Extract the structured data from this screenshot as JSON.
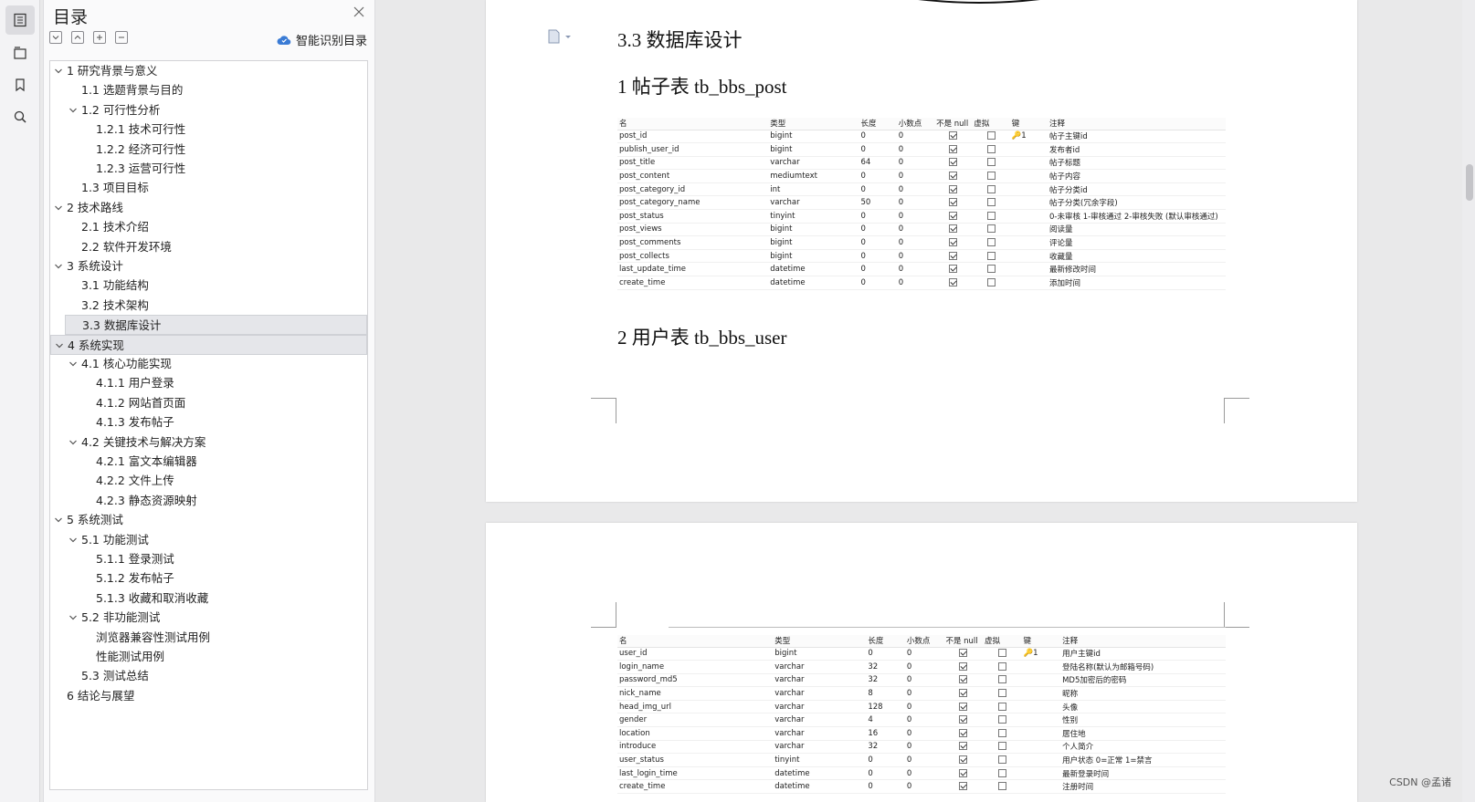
{
  "toc": {
    "title": "目录",
    "smart_label": "智能识别目录",
    "items": [
      {
        "text": "1  研究背景与意义",
        "level": 0,
        "chev": true
      },
      {
        "text": "1.1  选题背景与目的",
        "level": 1,
        "chev": false
      },
      {
        "text": "1.2  可行性分析",
        "level": 1,
        "chev": true
      },
      {
        "text": "1.2.1  技术可行性",
        "level": 2,
        "chev": false
      },
      {
        "text": "1.2.2  经济可行性",
        "level": 2,
        "chev": false
      },
      {
        "text": "1.2.3  运营可行性",
        "level": 2,
        "chev": false
      },
      {
        "text": "1.3  项目目标",
        "level": 1,
        "chev": false
      },
      {
        "text": "2  技术路线",
        "level": 0,
        "chev": true
      },
      {
        "text": "2.1  技术介绍",
        "level": 1,
        "chev": false
      },
      {
        "text": "2.2  软件开发环境",
        "level": 1,
        "chev": false
      },
      {
        "text": "3  系统设计",
        "level": 0,
        "chev": true
      },
      {
        "text": "3.1  功能结构",
        "level": 1,
        "chev": false
      },
      {
        "text": "3.2  技术架构",
        "level": 1,
        "chev": false
      },
      {
        "text": "3.3  数据库设计",
        "level": 1,
        "chev": false,
        "selected": true
      },
      {
        "text": "4  系统实现",
        "level": 0,
        "chev": true,
        "selected": true
      },
      {
        "text": "4.1  核心功能实现",
        "level": 1,
        "chev": true
      },
      {
        "text": "4.1.1  用户登录",
        "level": 2,
        "chev": false
      },
      {
        "text": "4.1.2  网站首页面",
        "level": 2,
        "chev": false
      },
      {
        "text": "4.1.3  发布帖子",
        "level": 2,
        "chev": false
      },
      {
        "text": "4.2  关键技术与解决方案",
        "level": 1,
        "chev": true
      },
      {
        "text": "4.2.1  富文本编辑器",
        "level": 2,
        "chev": false
      },
      {
        "text": "4.2.2  文件上传",
        "level": 2,
        "chev": false
      },
      {
        "text": "4.2.3  静态资源映射",
        "level": 2,
        "chev": false
      },
      {
        "text": "5  系统测试",
        "level": 0,
        "chev": true
      },
      {
        "text": "5.1  功能测试",
        "level": 1,
        "chev": true
      },
      {
        "text": "5.1.1  登录测试",
        "level": 2,
        "chev": false
      },
      {
        "text": "5.1.2  发布帖子",
        "level": 2,
        "chev": false
      },
      {
        "text": "5.1.3  收藏和取消收藏",
        "level": 2,
        "chev": false
      },
      {
        "text": "5.2  非功能测试",
        "level": 1,
        "chev": true
      },
      {
        "text": "浏览器兼容性测试用例",
        "level": 2,
        "chev": false
      },
      {
        "text": "性能测试用例",
        "level": 2,
        "chev": false
      },
      {
        "text": "5.3  测试总结",
        "level": 1,
        "chev": false
      },
      {
        "text": "6  结论与展望",
        "level": 0,
        "chev": false
      }
    ]
  },
  "doc": {
    "section_heading": "3.3  数据库设计",
    "post_heading": "1  帖子表  tb_bbs_post",
    "user_heading": "2  用户表  tb_bbs_user",
    "columns": [
      "名",
      "类型",
      "长度",
      "小数点",
      "不是 null",
      "虚拟",
      "键",
      "注释"
    ],
    "post_rows": [
      {
        "name": "post_id",
        "type": "bigint",
        "len": "0",
        "dec": "0",
        "notnull": true,
        "virtual": false,
        "key": "1",
        "comment": "帖子主键id"
      },
      {
        "name": "publish_user_id",
        "type": "bigint",
        "len": "0",
        "dec": "0",
        "notnull": true,
        "virtual": false,
        "key": "",
        "comment": "发布者id"
      },
      {
        "name": "post_title",
        "type": "varchar",
        "len": "64",
        "dec": "0",
        "notnull": true,
        "virtual": false,
        "key": "",
        "comment": "帖子标题"
      },
      {
        "name": "post_content",
        "type": "mediumtext",
        "len": "0",
        "dec": "0",
        "notnull": true,
        "virtual": false,
        "key": "",
        "comment": "帖子内容"
      },
      {
        "name": "post_category_id",
        "type": "int",
        "len": "0",
        "dec": "0",
        "notnull": true,
        "virtual": false,
        "key": "",
        "comment": "帖子分类id"
      },
      {
        "name": "post_category_name",
        "type": "varchar",
        "len": "50",
        "dec": "0",
        "notnull": true,
        "virtual": false,
        "key": "",
        "comment": "帖子分类(冗余字段)"
      },
      {
        "name": "post_status",
        "type": "tinyint",
        "len": "0",
        "dec": "0",
        "notnull": true,
        "virtual": false,
        "key": "",
        "comment": "0-未审核 1-审核通过 2-审核失败 (默认审核通过)"
      },
      {
        "name": "post_views",
        "type": "bigint",
        "len": "0",
        "dec": "0",
        "notnull": true,
        "virtual": false,
        "key": "",
        "comment": "阅读量"
      },
      {
        "name": "post_comments",
        "type": "bigint",
        "len": "0",
        "dec": "0",
        "notnull": true,
        "virtual": false,
        "key": "",
        "comment": "评论量"
      },
      {
        "name": "post_collects",
        "type": "bigint",
        "len": "0",
        "dec": "0",
        "notnull": true,
        "virtual": false,
        "key": "",
        "comment": "收藏量"
      },
      {
        "name": "last_update_time",
        "type": "datetime",
        "len": "0",
        "dec": "0",
        "notnull": true,
        "virtual": false,
        "key": "",
        "comment": "最新修改时间"
      },
      {
        "name": "create_time",
        "type": "datetime",
        "len": "0",
        "dec": "0",
        "notnull": true,
        "virtual": false,
        "key": "",
        "comment": "添加时间"
      }
    ],
    "user_rows": [
      {
        "name": "user_id",
        "type": "bigint",
        "len": "0",
        "dec": "0",
        "notnull": true,
        "virtual": false,
        "key": "1",
        "comment": "用户主键id"
      },
      {
        "name": "login_name",
        "type": "varchar",
        "len": "32",
        "dec": "0",
        "notnull": true,
        "virtual": false,
        "key": "",
        "comment": "登陆名称(默认为邮箱号码)"
      },
      {
        "name": "password_md5",
        "type": "varchar",
        "len": "32",
        "dec": "0",
        "notnull": true,
        "virtual": false,
        "key": "",
        "comment": "MD5加密后的密码"
      },
      {
        "name": "nick_name",
        "type": "varchar",
        "len": "8",
        "dec": "0",
        "notnull": true,
        "virtual": false,
        "key": "",
        "comment": "昵称"
      },
      {
        "name": "head_img_url",
        "type": "varchar",
        "len": "128",
        "dec": "0",
        "notnull": true,
        "virtual": false,
        "key": "",
        "comment": "头像"
      },
      {
        "name": "gender",
        "type": "varchar",
        "len": "4",
        "dec": "0",
        "notnull": true,
        "virtual": false,
        "key": "",
        "comment": "性别"
      },
      {
        "name": "location",
        "type": "varchar",
        "len": "16",
        "dec": "0",
        "notnull": true,
        "virtual": false,
        "key": "",
        "comment": "居住地"
      },
      {
        "name": "introduce",
        "type": "varchar",
        "len": "32",
        "dec": "0",
        "notnull": true,
        "virtual": false,
        "key": "",
        "comment": "个人简介"
      },
      {
        "name": "user_status",
        "type": "tinyint",
        "len": "0",
        "dec": "0",
        "notnull": true,
        "virtual": false,
        "key": "",
        "comment": "用户状态 0=正常 1=禁言"
      },
      {
        "name": "last_login_time",
        "type": "datetime",
        "len": "0",
        "dec": "0",
        "notnull": true,
        "virtual": false,
        "key": "",
        "comment": "最新登录时间"
      },
      {
        "name": "create_time",
        "type": "datetime",
        "len": "0",
        "dec": "0",
        "notnull": true,
        "virtual": false,
        "key": "",
        "comment": "注册时间"
      }
    ]
  },
  "watermark": "CSDN @孟诸"
}
